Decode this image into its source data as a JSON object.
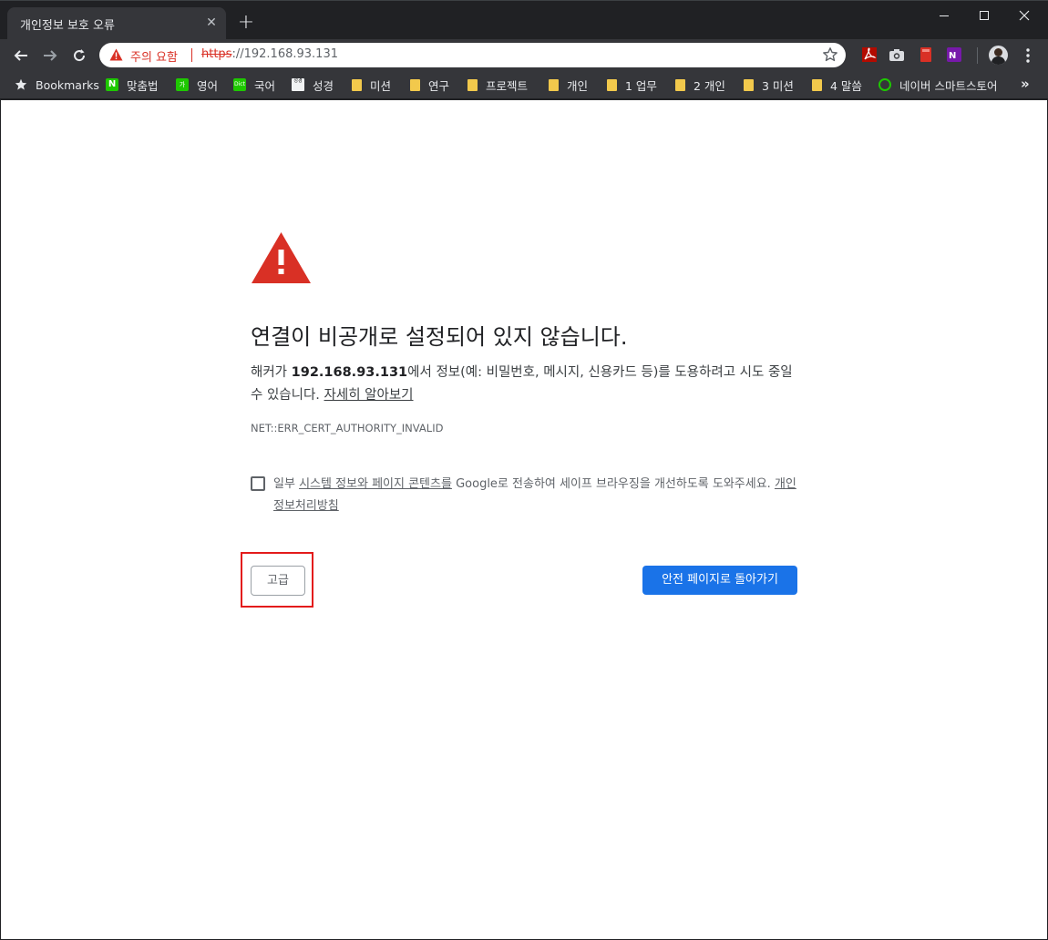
{
  "tab": {
    "title": "개인정보 보호 오류",
    "close_glyph": "✕",
    "new_tab_glyph": "+"
  },
  "omnibox": {
    "status": "주의 요함",
    "url_scheme": "https",
    "url_rest": "://192.168.93.131"
  },
  "bookmarks": {
    "items": [
      {
        "label": "Bookmarks",
        "icon": "star-icon"
      },
      {
        "label": "맞춤법",
        "icon": "naver-icon",
        "icon_text": "N"
      },
      {
        "label": "영어",
        "icon": "naver-dict-icon",
        "icon_text": "가"
      },
      {
        "label": "국어",
        "icon": "dict-icon",
        "icon_text": "Dict"
      },
      {
        "label": "성경",
        "icon": "bible-icon",
        "icon_text": "성경"
      },
      {
        "label": "미션",
        "icon": "folder-icon"
      },
      {
        "label": "연구",
        "icon": "folder-icon"
      },
      {
        "label": "프로젝트",
        "icon": "folder-icon"
      },
      {
        "label": "개인",
        "icon": "folder-icon"
      },
      {
        "label": "1 업무",
        "icon": "folder-icon"
      },
      {
        "label": "2 개인",
        "icon": "folder-icon"
      },
      {
        "label": "3 미션",
        "icon": "folder-icon"
      },
      {
        "label": "4 말씀",
        "icon": "folder-icon"
      },
      {
        "label": "네이버 스마트스토어",
        "icon": "smartstore-icon"
      }
    ],
    "more_glyph": "»"
  },
  "page": {
    "heading": "연결이 비공개로 설정되어 있지 않습니다.",
    "desc_prefix": "해커가 ",
    "desc_host": "192.168.93.131",
    "desc_suffix": "에서 정보(예: 비밀번호, 메시지, 신용카드 등)를 도용하려고 시도 중일 수 있습니다. ",
    "learn_more": "자세히 알아보기",
    "error_code": "NET::ERR_CERT_AUTHORITY_INVALID",
    "optin_prefix": "일부 ",
    "optin_link": "시스템 정보와 페이지 콘텐츠를",
    "optin_middle": " Google로 전송하여 세이프 브라우징을 개선하도록 도와주세요. ",
    "optin_policy": "개인정보처리방침",
    "advanced_button": "고급",
    "back_button": "안전 페이지로 돌아가기"
  },
  "colors": {
    "warning_red": "#d93025",
    "primary_blue": "#1a73e8",
    "highlight_red": "#e31b1b",
    "chrome_dark": "#202124",
    "toolbar_dark": "#35363a"
  }
}
